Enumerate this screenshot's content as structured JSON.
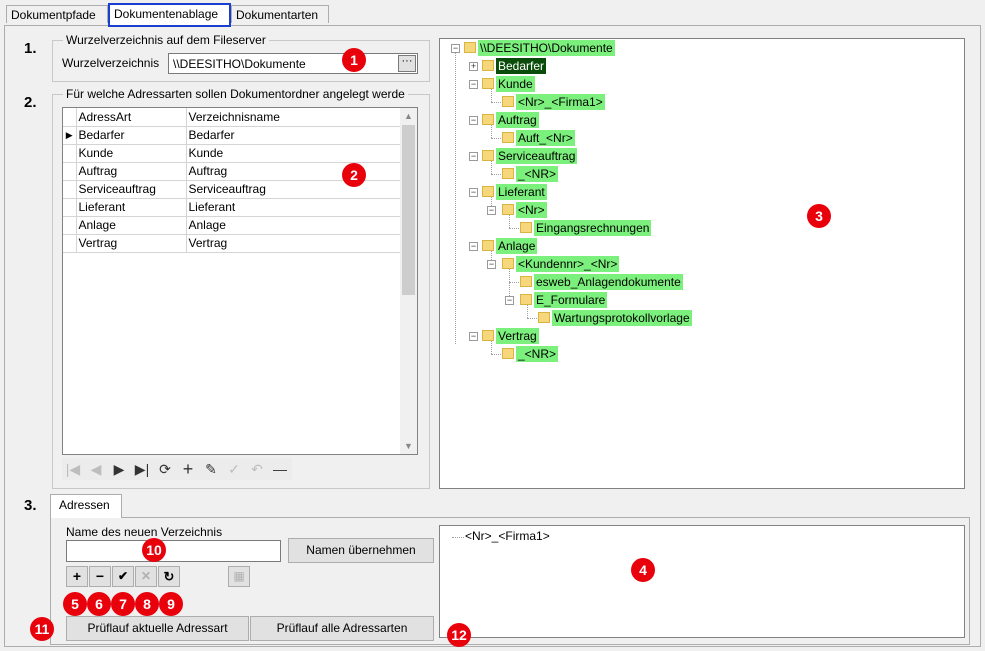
{
  "tabs": [
    "Dokumentpfade",
    "Dokumentenablage",
    "Dokumentarten"
  ],
  "active_tab": 1,
  "steps": [
    "1.",
    "2.",
    "3."
  ],
  "root_group": {
    "label": "Wurzelverzeichnis auf dem Fileserver",
    "field_label": "Wurzelverzeichnis",
    "value": "\\\\DEESITHO\\Dokumente",
    "browse": "···"
  },
  "address_group": {
    "label": "Für welche Adressarten sollen Dokumentordner angelegt werde",
    "columns": [
      "AdressArt",
      "Verzeichnisname"
    ],
    "rows": [
      [
        "Bedarfer",
        "Bedarfer"
      ],
      [
        "Kunde",
        "Kunde"
      ],
      [
        "Auftrag",
        "Auftrag"
      ],
      [
        "Serviceauftrag",
        "Serviceauftrag"
      ],
      [
        "Lieferant",
        "Lieferant"
      ],
      [
        "Anlage",
        "Anlage"
      ],
      [
        "Vertrag",
        "Vertrag"
      ]
    ],
    "current_row_indicator": "▶"
  },
  "nav": {
    "first": "|◀",
    "prev": "◀",
    "next": "▶",
    "last": "▶|",
    "refresh": "⟳",
    "add": "+",
    "edit": "✎",
    "post": "✓",
    "cancel": "↶",
    "delete": "—"
  },
  "tree": {
    "root": "\\\\DEESITHO\\Dokumente",
    "nodes": [
      "Bedarfer",
      "Kunde",
      "<Nr>_<Firma1>",
      "Auftrag",
      "Auft_<Nr>",
      "Serviceauftrag",
      "_<NR>",
      "Lieferant",
      "<Nr>",
      "Eingangsrechnungen",
      "Anlage",
      "<Kundennr>_<Nr>",
      "esweb_Anlagendokumente",
      "E_Formulare",
      "Wartungsprotokollvorlage",
      "Vertrag",
      "_<NR>"
    ]
  },
  "bottom": {
    "subtab": "Adressen",
    "new_dir_label": "Name des neuen Verzeichnis",
    "new_dir_value": "",
    "apply_button": "Namen übernehmen",
    "icons": {
      "add": "+",
      "remove": "−",
      "confirm": "✔",
      "cancel": "✕",
      "redo": "↻",
      "extra": "▦"
    },
    "check_current": "Prüflauf aktuelle Adressart",
    "check_all": "Prüflauf alle Adressarten",
    "preview_item": "<Nr>_<Firma1>"
  },
  "markers": [
    "1",
    "2",
    "3",
    "4",
    "5",
    "6",
    "7",
    "8",
    "9",
    "10",
    "11",
    "12"
  ],
  "colors": {
    "marker": "#e8000b",
    "tree_highlight": "#7cf07c",
    "tree_selected": "#0a4d0a",
    "active_tab_border": "#1a3fd0"
  }
}
